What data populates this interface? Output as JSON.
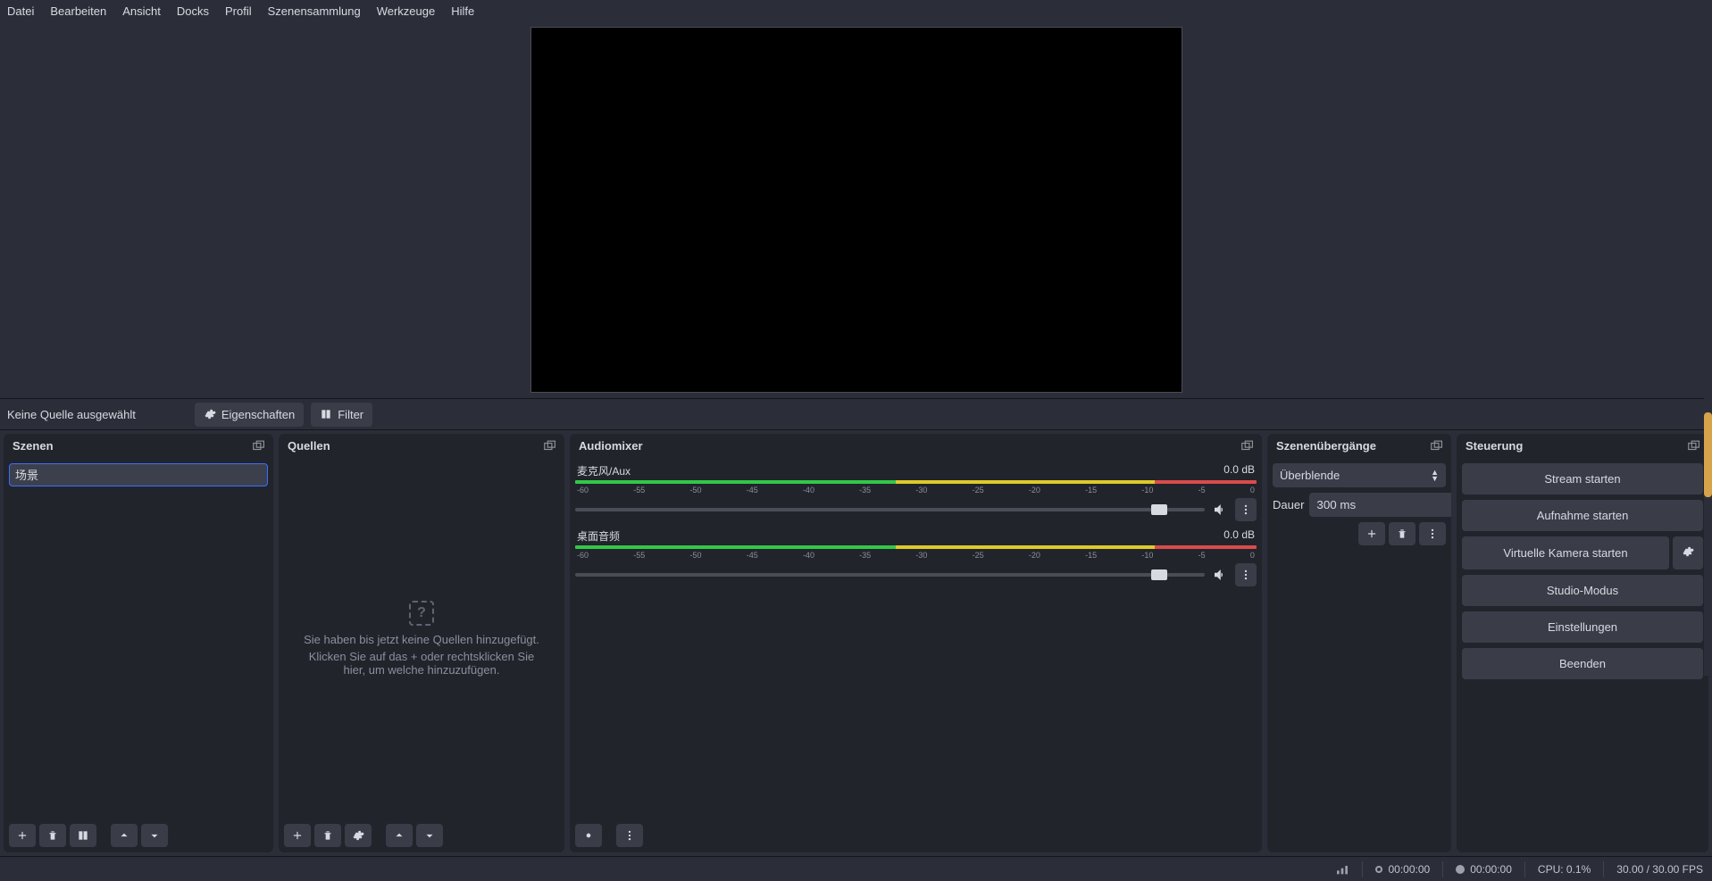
{
  "menubar": [
    "Datei",
    "Bearbeiten",
    "Ansicht",
    "Docks",
    "Profil",
    "Szenensammlung",
    "Werkzeuge",
    "Hilfe"
  ],
  "source_toolbar": {
    "no_source": "Keine Quelle ausgewählt",
    "properties": "Eigenschaften",
    "filters": "Filter"
  },
  "scenes": {
    "title": "Szenen",
    "items": [
      "场景"
    ]
  },
  "sources": {
    "title": "Quellen",
    "empty1": "Sie haben bis jetzt keine Quellen hinzugefügt.",
    "empty2": "Klicken Sie auf das + oder rechtsklicken Sie hier, um welche hinzuzufügen."
  },
  "audio": {
    "title": "Audiomixer",
    "scale": [
      "-60",
      "-55",
      "-50",
      "-45",
      "-40",
      "-35",
      "-30",
      "-25",
      "-20",
      "-15",
      "-10",
      "-5",
      "0"
    ],
    "channels": [
      {
        "name": "麦克风/Aux",
        "db": "0.0 dB"
      },
      {
        "name": "桌面音频",
        "db": "0.0 dB"
      }
    ]
  },
  "transitions": {
    "title": "Szenenübergänge",
    "selected": "Überblende",
    "dur_label": "Dauer",
    "dur_value": "300 ms"
  },
  "controls": {
    "title": "Steuerung",
    "stream": "Stream starten",
    "record": "Aufnahme starten",
    "vcam": "Virtuelle Kamera starten",
    "studio": "Studio-Modus",
    "settings": "Einstellungen",
    "exit": "Beenden"
  },
  "status": {
    "stream_time": "00:00:00",
    "rec_time": "00:00:00",
    "cpu": "CPU: 0.1%",
    "fps": "30.00 / 30.00 FPS"
  }
}
